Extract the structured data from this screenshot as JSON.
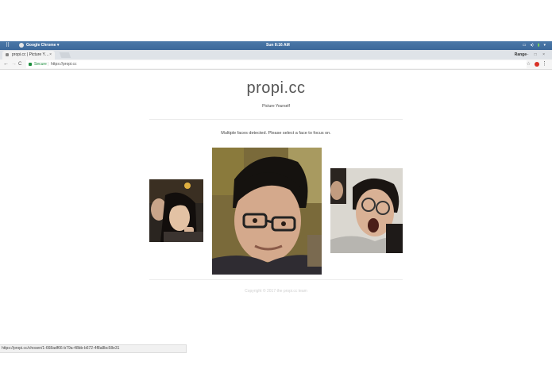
{
  "os": {
    "app_name": "Google Chrome ▾",
    "clock": "Sun 8:16 AM",
    "apps_icon": "apps-grid-icon"
  },
  "browser": {
    "tab_title": "propi.cc | Picture Y…",
    "tab_close": "×",
    "profile": "Range",
    "window_controls": "– □ ×",
    "back": "←",
    "forward": "→",
    "reload": "C",
    "secure_label": "Secure",
    "separator": "|",
    "url": "https://propi.cc",
    "star": "☆",
    "menu": "⋮",
    "accent_color": "#4a76a8"
  },
  "page": {
    "title": "propi.cc",
    "tagline": "Picture Yourself",
    "instruction": "Multiple faces detected. Please select a face to focus on.",
    "faces": [
      {
        "name": "face-option-left"
      },
      {
        "name": "face-option-center"
      },
      {
        "name": "face-option-right"
      }
    ],
    "footer": "Copyright © 2017 the propi.cc team"
  },
  "status_bar": {
    "link_url": "https://propi.cc/chosen/1-668adf66-b79a-48bb-b672-4f8a8bc58e31"
  }
}
